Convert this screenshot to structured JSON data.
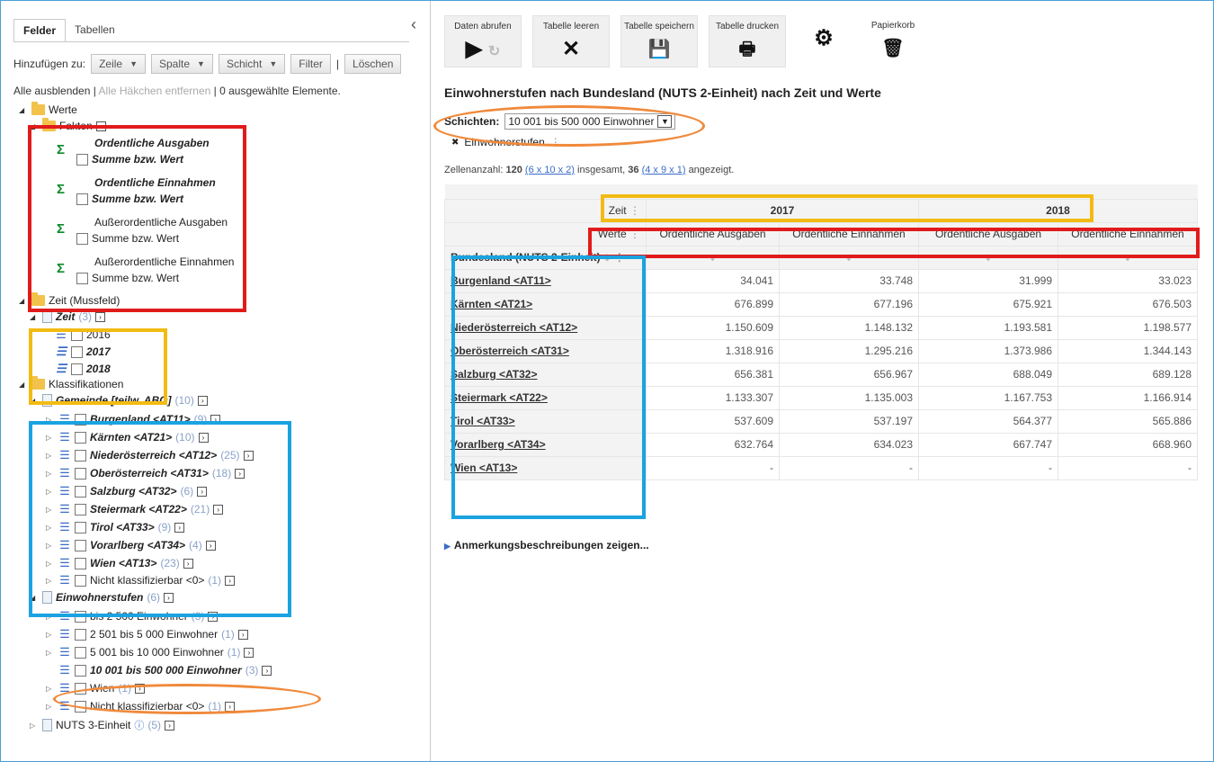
{
  "left": {
    "tabs": [
      "Felder",
      "Tabellen"
    ],
    "add_label": "Hinzufügen zu:",
    "buttons": {
      "zeile": "Zeile",
      "spalte": "Spalte",
      "schicht": "Schicht",
      "filter": "Filter",
      "loeschen": "Löschen"
    },
    "selection": {
      "hide_all": "Alle ausblenden",
      "remove_checks": "Alle Häkchen entfernen",
      "selected": "0 ausgewählte Elemente."
    },
    "tree": {
      "werte": "Werte",
      "fakten": "Fakten",
      "facts": [
        {
          "name": "Ordentliche Ausgaben",
          "measure": "Summe bzw. Wert"
        },
        {
          "name": "Ordentliche Einnahmen",
          "measure": "Summe bzw. Wert"
        },
        {
          "name": "Außerordentliche Ausgaben",
          "measure": "Summe bzw. Wert"
        },
        {
          "name": "Außerordentliche Einnahmen",
          "measure": "Summe bzw. Wert"
        }
      ],
      "zeit_mussfeld": "Zeit (Mussfeld)",
      "zeit": "Zeit",
      "zeit_count": "(3)",
      "years": [
        "2016",
        "2017",
        "2018"
      ],
      "klassifikationen": "Klassifikationen",
      "gemeinde": "Gemeinde [teilw. ABO]",
      "gemeinde_count": "(10)",
      "states": [
        {
          "name": "Burgenland <AT11>",
          "count": "(9)"
        },
        {
          "name": "Kärnten <AT21>",
          "count": "(10)"
        },
        {
          "name": "Niederösterreich <AT12>",
          "count": "(25)"
        },
        {
          "name": "Oberösterreich <AT31>",
          "count": "(18)"
        },
        {
          "name": "Salzburg <AT32>",
          "count": "(6)"
        },
        {
          "name": "Steiermark <AT22>",
          "count": "(21)"
        },
        {
          "name": "Tirol <AT33>",
          "count": "(9)"
        },
        {
          "name": "Vorarlberg <AT34>",
          "count": "(4)"
        },
        {
          "name": "Wien <AT13>",
          "count": "(23)"
        },
        {
          "name": "Nicht klassifizierbar <0>",
          "count": "(1)"
        }
      ],
      "einwohnerstufen": "Einwohnerstufen",
      "einwohnerstufen_count": "(6)",
      "stufen": [
        {
          "name": "bis 2 500 Einwohner",
          "count": "(3)"
        },
        {
          "name": "2 501 bis 5 000 Einwohner",
          "count": "(1)"
        },
        {
          "name": "5 001 bis 10 000 Einwohner",
          "count": "(1)"
        },
        {
          "name": "10 001 bis 500 000 Einwohner",
          "count": "(3)"
        },
        {
          "name": "Wien",
          "count": "(1)"
        },
        {
          "name": "Nicht klassifizierbar <0>",
          "count": "(1)"
        }
      ],
      "nuts3": "NUTS 3-Einheit",
      "nuts3_count": "(5)"
    }
  },
  "toolbar": {
    "fetch": "Daten abrufen",
    "clear": "Tabelle leeren",
    "save": "Tabelle speichern",
    "print": "Tabelle drucken",
    "trash": "Papierkorb"
  },
  "main": {
    "title": "Einwohnerstufen nach Bundesland (NUTS 2-Einheit) nach Zeit und Werte",
    "layers_label": "Schichten:",
    "layer_value": "10 001 bis 500 000 Einwohner",
    "layer_dim": "Einwohnerstufen",
    "cell_info_prefix": "Zellenanzahl:",
    "cell_total": "120",
    "cell_total_formula": "(6 x 10 x 2)",
    "cell_mid": "insgesamt,",
    "cell_shown": "36",
    "cell_shown_formula": "(4 x 9 x 1)",
    "cell_suffix": "angezeigt.",
    "col_dim_zeit": "Zeit",
    "col_dim_werte": "Werte",
    "row_dim": "Bundesland (NUTS 2-Einheit)",
    "years": [
      "2017",
      "2018"
    ],
    "measures": [
      "Ordentliche Ausgaben",
      "Ordentliche Einnahmen",
      "Ordentliche Ausgaben",
      "Ordentliche Einnahmen"
    ],
    "rows": [
      {
        "name": "Burgenland <AT11>",
        "values": [
          "34.041",
          "33.748",
          "31.999",
          "33.023"
        ]
      },
      {
        "name": "Kärnten <AT21>",
        "values": [
          "676.899",
          "677.196",
          "675.921",
          "676.503"
        ]
      },
      {
        "name": "Niederösterreich <AT12>",
        "values": [
          "1.150.609",
          "1.148.132",
          "1.193.581",
          "1.198.577"
        ]
      },
      {
        "name": "Oberösterreich <AT31>",
        "values": [
          "1.318.916",
          "1.295.216",
          "1.373.986",
          "1.344.143"
        ]
      },
      {
        "name": "Salzburg <AT32>",
        "values": [
          "656.381",
          "656.967",
          "688.049",
          "689.128"
        ]
      },
      {
        "name": "Steiermark <AT22>",
        "values": [
          "1.133.307",
          "1.135.003",
          "1.167.753",
          "1.166.914"
        ]
      },
      {
        "name": "Tirol <AT33>",
        "values": [
          "537.609",
          "537.197",
          "564.377",
          "565.886"
        ]
      },
      {
        "name": "Vorarlberg <AT34>",
        "values": [
          "632.764",
          "634.023",
          "667.747",
          "668.960"
        ]
      },
      {
        "name": "Wien <AT13>",
        "values": [
          "-",
          "-",
          "-",
          "-"
        ]
      }
    ],
    "notes": "Anmerkungsbeschreibungen zeigen..."
  },
  "colors": {
    "highlight_red": "#e01b1b",
    "highlight_yellow": "#f2bb13",
    "highlight_blue": "#1aa3e0",
    "highlight_orange": "#f08a3c",
    "link": "#3a6cc6"
  }
}
